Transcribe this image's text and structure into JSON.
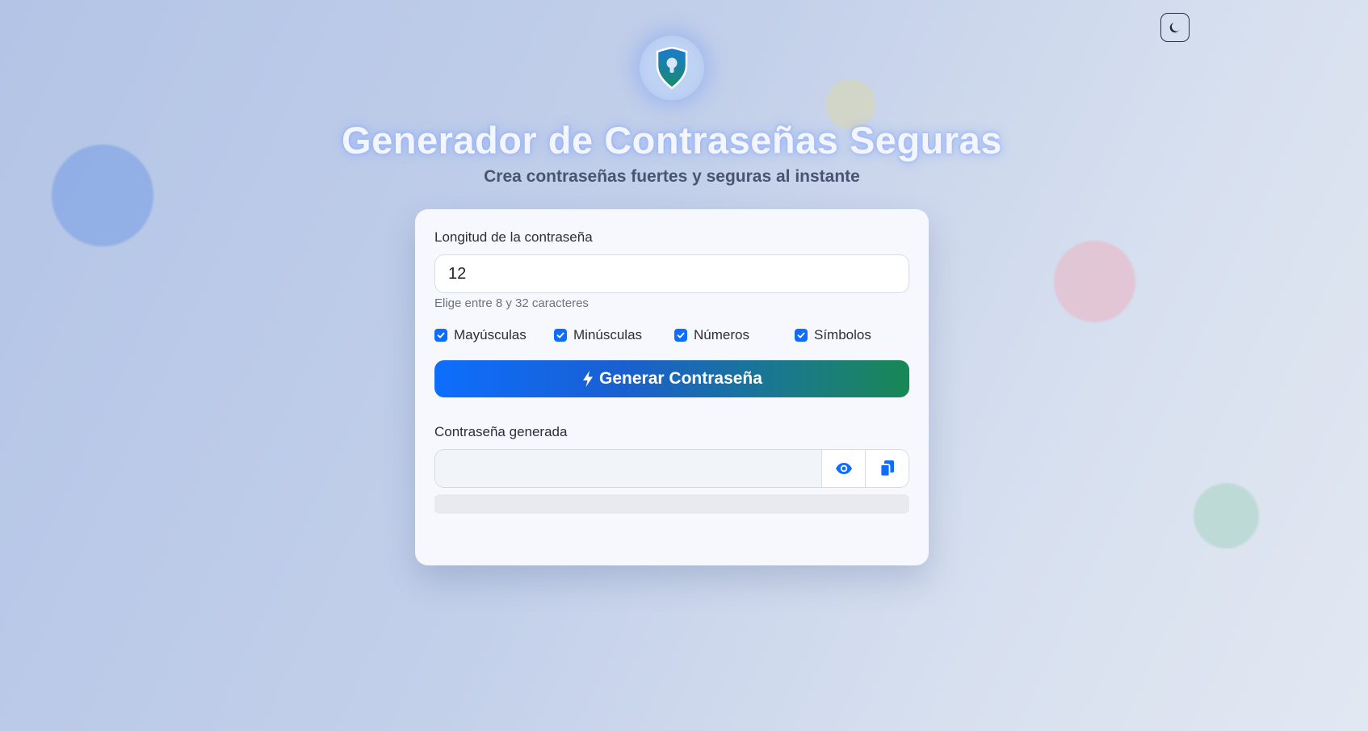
{
  "theme_toggle": {
    "icon": "moon-icon"
  },
  "logo": {
    "icon": "shield-keyhole-icon"
  },
  "header": {
    "title": "Generador de Contraseñas Seguras",
    "subtitle": "Crea contraseñas fuertes y seguras al instante"
  },
  "form": {
    "length_label": "Longitud de la contraseña",
    "length_value": "12",
    "length_hint": "Elige entre 8 y 32 caracteres",
    "options": [
      {
        "label": "Mayúsculas",
        "checked": true
      },
      {
        "label": "Minúsculas",
        "checked": true
      },
      {
        "label": "Números",
        "checked": true
      },
      {
        "label": "Símbolos",
        "checked": true
      }
    ],
    "generate_label": "Generar Contraseña",
    "output_label": "Contraseña generada",
    "output_value": "",
    "strength": 0
  },
  "colors": {
    "primary": "#0d6efd",
    "success": "#198754"
  }
}
